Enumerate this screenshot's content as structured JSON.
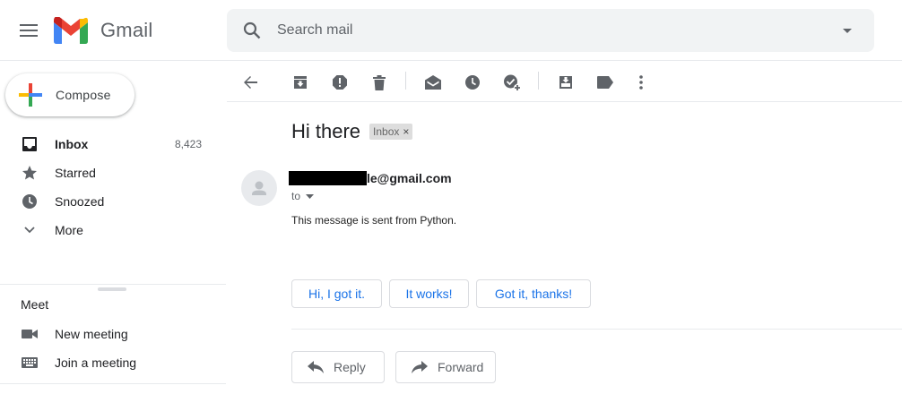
{
  "app": {
    "name": "Gmail"
  },
  "search": {
    "placeholder": "Search mail"
  },
  "compose": {
    "label": "Compose"
  },
  "nav": {
    "items": [
      {
        "label": "Inbox",
        "count": "8,423",
        "icon": "inbox-icon",
        "active": true
      },
      {
        "label": "Starred",
        "count": "",
        "icon": "star-icon"
      },
      {
        "label": "Snoozed",
        "count": "",
        "icon": "clock-icon"
      },
      {
        "label": "More",
        "count": "",
        "icon": "chevron-down-icon"
      }
    ]
  },
  "meet": {
    "title": "Meet",
    "items": [
      {
        "label": "New meeting",
        "icon": "video-camera-icon"
      },
      {
        "label": "Join a meeting",
        "icon": "keyboard-icon"
      }
    ]
  },
  "email": {
    "subject": "Hi there",
    "label_chip": "Inbox",
    "label_remove": "×",
    "sender_suffix": "le@gmail.com",
    "to": "to",
    "body": "This message is sent from Python."
  },
  "smart_replies": [
    "Hi, I got it.",
    "It works!",
    "Got it, thanks!"
  ],
  "actions": {
    "reply": "Reply",
    "forward": "Forward"
  },
  "colors": {
    "accent": "#1a73e8",
    "icon": "#5f6368",
    "search_bg": "#f1f3f4"
  }
}
